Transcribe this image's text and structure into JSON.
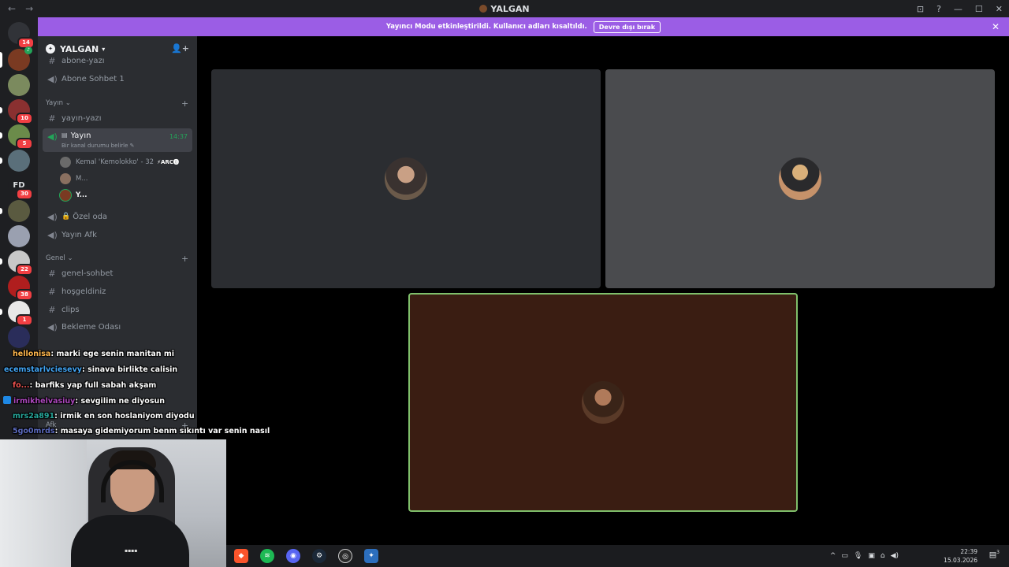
{
  "window": {
    "title": "YALGAN",
    "back_icon": "←",
    "forward_icon": "→",
    "controls": [
      "⊡",
      "?",
      "—",
      "☐",
      "✕"
    ]
  },
  "banner": {
    "text": "Yayıncı Modu etkinleştirildi. Kullanıcı adları kısaltıldı.",
    "button": "Devre dışı bırak",
    "close": "✕"
  },
  "rail": {
    "badges": [
      "14",
      "10",
      "5",
      "30",
      "22",
      "38",
      "1"
    ],
    "fd_label": "FD"
  },
  "server": {
    "name": "YALGAN",
    "invite_icon": "👤+"
  },
  "channels": {
    "top_partial": "abone-yazı",
    "abone_sohbet": "Abone Sohbet 1",
    "cat_yayin": "Yayın",
    "yayin_yazi": "yayın-yazı",
    "active": {
      "name": "Yayın",
      "time": "14:37",
      "status": "Bir kanal durumu belirle"
    },
    "voice_users": [
      {
        "name": "Kemal 'Kemolokko' - 32",
        "tag": "⚡ARC⓿"
      },
      {
        "name": "M..."
      },
      {
        "name": "Y..."
      }
    ],
    "ozel_oda": "Özel oda",
    "yayin_afk": "Yayın Afk",
    "cat_genel": "Genel",
    "genel_sohbet": "genel-sohbet",
    "hosgeldiniz": "hoşgeldiniz",
    "clips": "clips",
    "bekleme": "Bekleme Odası",
    "cat_afk": "Afk"
  },
  "chat": [
    {
      "user": "hellonisa",
      "user_color": "#ffb74d",
      "text": ": marki ege senin manitan mi"
    },
    {
      "user": "ecemstarlvciesevy",
      "user_color": "#42a5f5",
      "text": ": sinava birlikte calisin"
    },
    {
      "user": "fo...",
      "user_color": "#ef5350",
      "text": ": barfiks yap full sabah akşam"
    },
    {
      "user": "irmikhelvasiuy",
      "user_color": "#ab47bc",
      "text": ": sevgilim ne diyosun"
    },
    {
      "user": "mrs2a891",
      "user_color": "#26a69a",
      "text": ": irmik en son hoslaniyom diyodu"
    },
    {
      "user": "5go0mrds",
      "user_color": "#5c6bc0",
      "text": ": masaya gidemiyorum benm sıkıntı var senin nasıl"
    }
  ],
  "taskbar": {
    "clock_time": "22:39",
    "clock_date": "15.03.2026",
    "tray_up": "^",
    "notif_count": "3"
  },
  "colors": {
    "banner": "#9b5de5",
    "tile_left": "#2b2d31",
    "tile_right": "#4a4b4e",
    "tile_speaking": "#3a1d12",
    "speaking_ring": "#7fbf6a"
  }
}
